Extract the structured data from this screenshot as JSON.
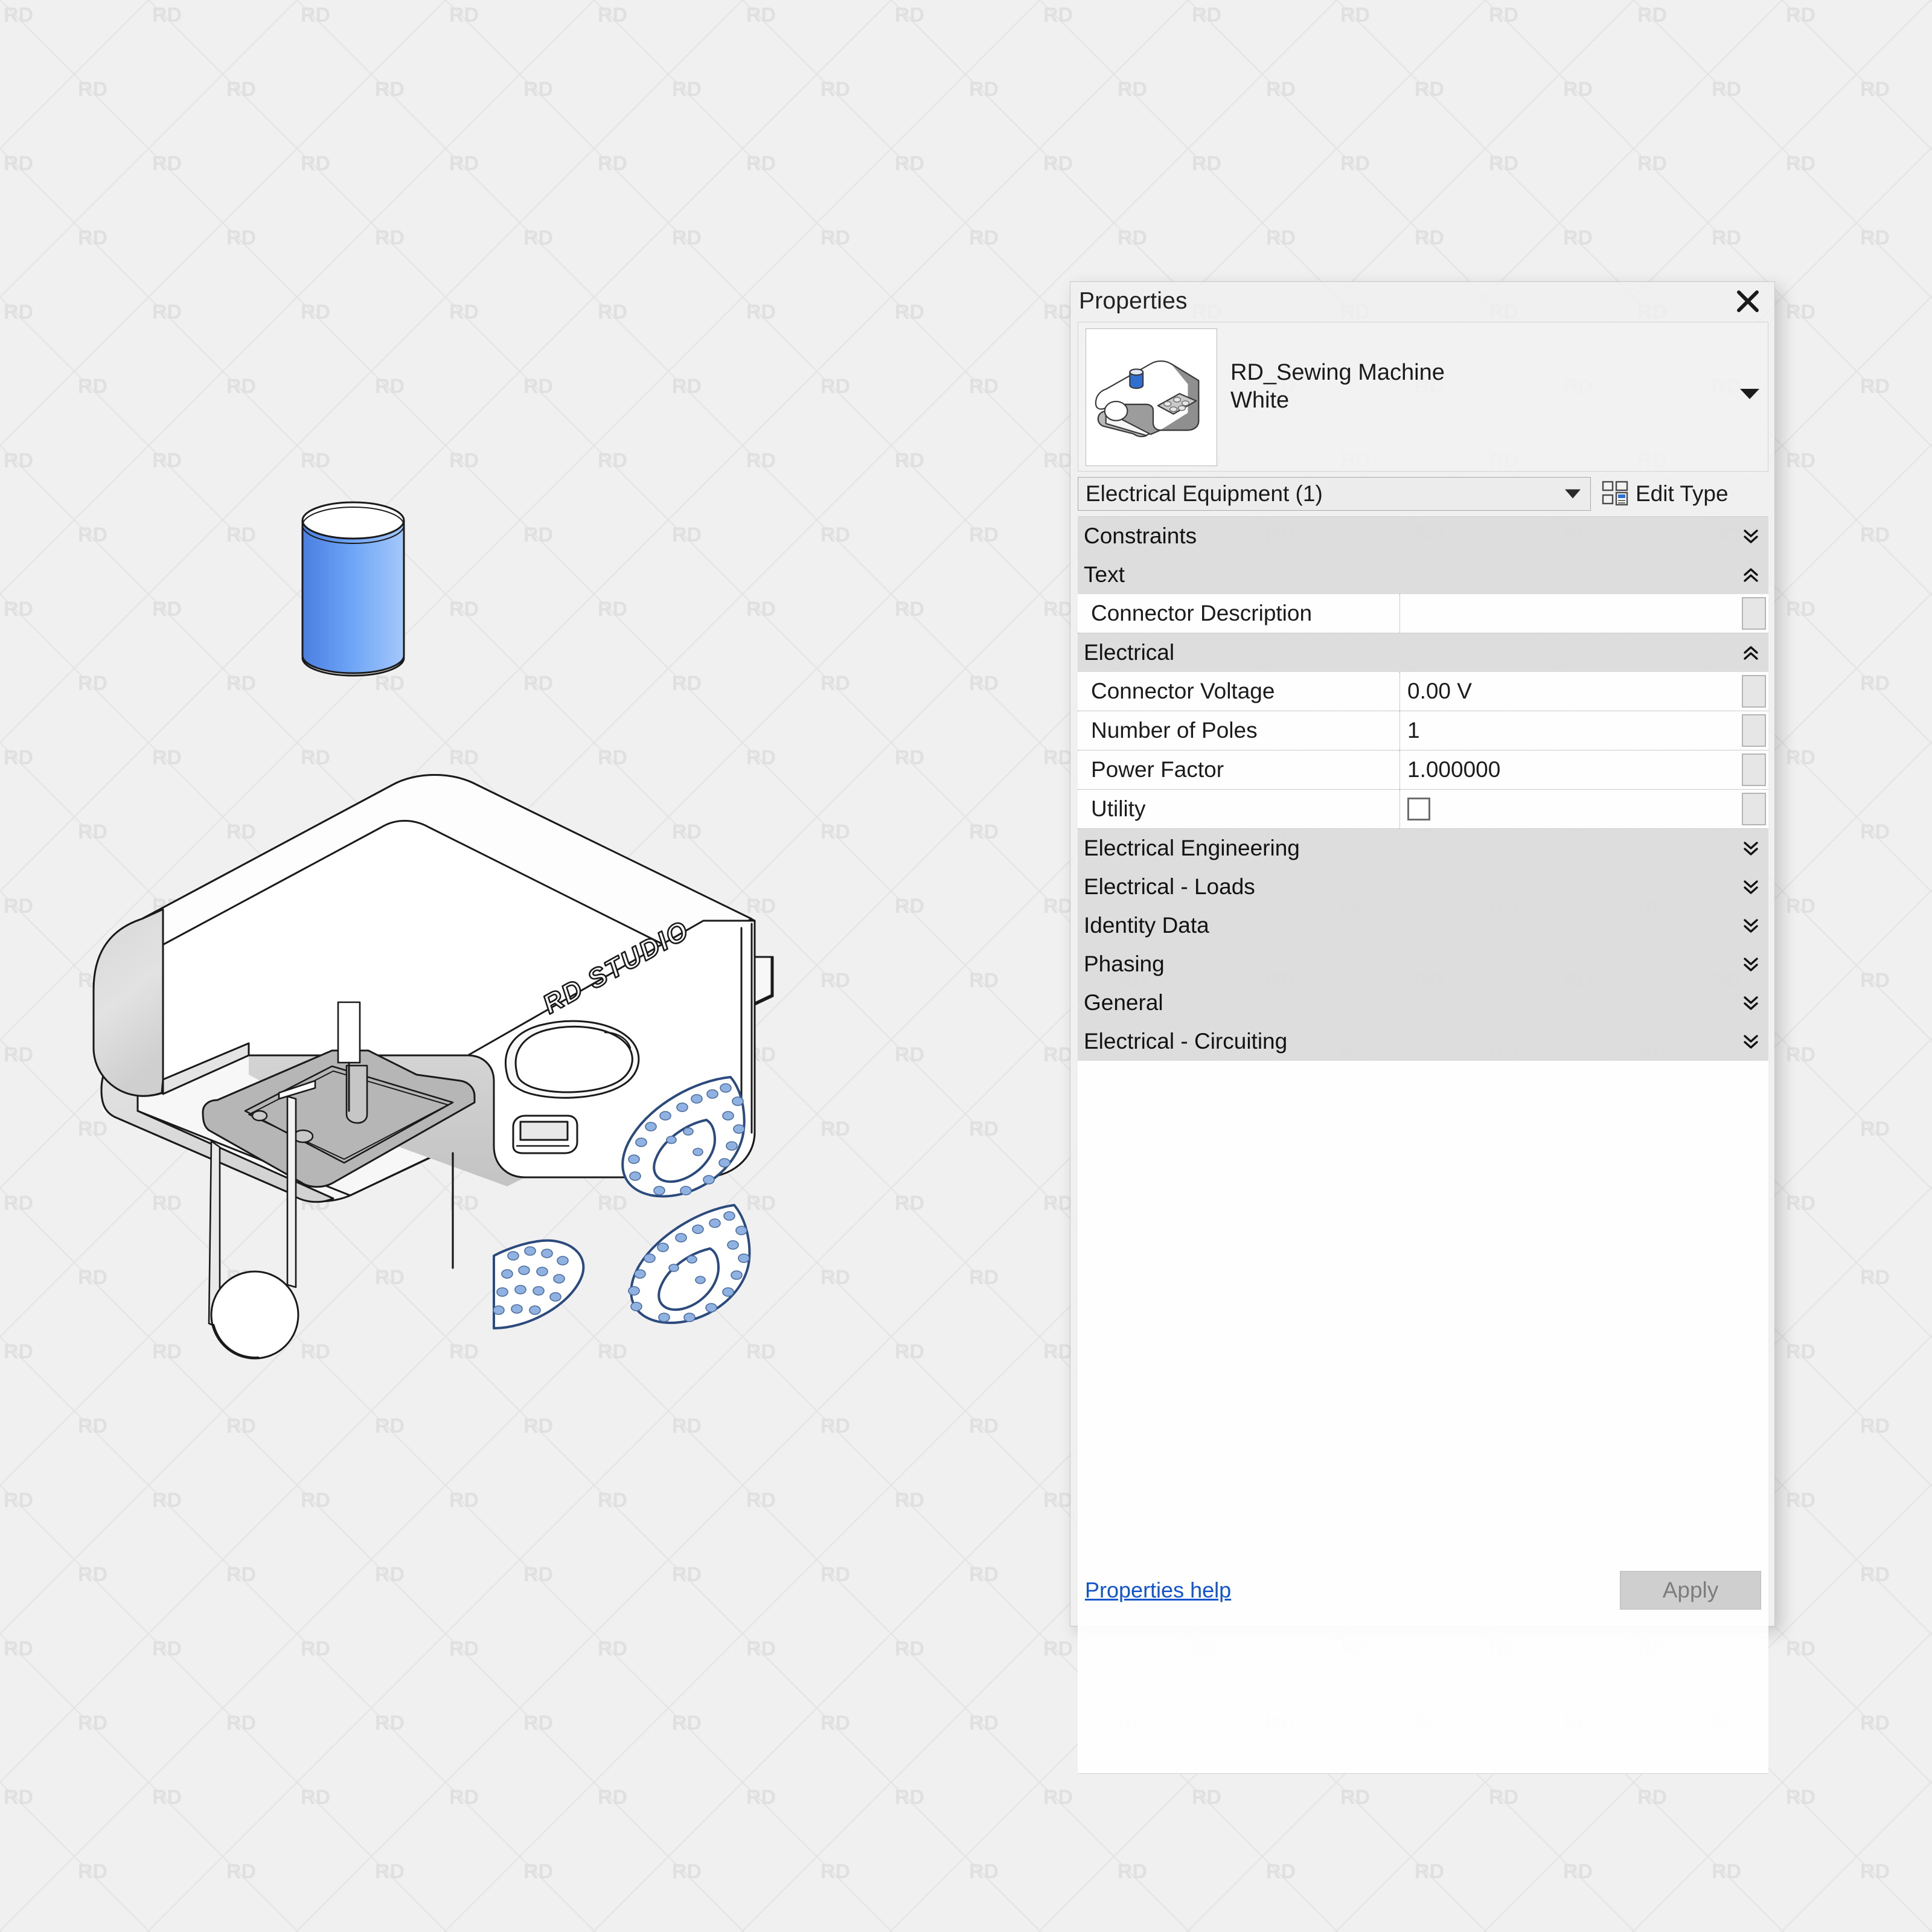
{
  "background": {
    "watermark_text": "RD",
    "bg_color": "#f0f0f0",
    "watermark_color": "#e2e2e2"
  },
  "panel": {
    "title": "Properties",
    "close_icon": "close-icon",
    "type_name_line1": "RD_Sewing Machine",
    "type_name_line2": "White",
    "type_dropdown_icon": "chevron-down-icon",
    "category": "Electrical Equipment (1)",
    "category_caret_icon": "chevron-down-icon",
    "edit_type_label": "Edit Type",
    "edit_type_icon": "edit-type-icon",
    "preview_icon": "sewing-machine-preview",
    "help_link": "Properties help",
    "apply_label": "Apply"
  },
  "prop_grid": {
    "rows": [
      {
        "kind": "group",
        "label": "Constraints",
        "state": "collapsed",
        "chev": "chevron-double-down-icon"
      },
      {
        "kind": "group",
        "label": "Text",
        "state": "expanded",
        "chev": "chevron-double-up-icon"
      },
      {
        "kind": "prop",
        "label": "Connector Description",
        "value": "",
        "value_type": "text"
      },
      {
        "kind": "group",
        "label": "Electrical",
        "state": "expanded",
        "chev": "chevron-double-up-icon"
      },
      {
        "kind": "prop",
        "label": "Connector Voltage",
        "value": "0.00 V",
        "value_type": "text"
      },
      {
        "kind": "prop",
        "label": "Number of Poles",
        "value": "1",
        "value_type": "text"
      },
      {
        "kind": "prop",
        "label": "Power Factor",
        "value": "1.000000",
        "value_type": "text"
      },
      {
        "kind": "prop",
        "label": "Utility",
        "value": "",
        "value_type": "checkbox",
        "checked": false
      },
      {
        "kind": "group",
        "label": "Electrical Engineering",
        "state": "collapsed",
        "chev": "chevron-double-down-icon"
      },
      {
        "kind": "group",
        "label": "Electrical - Loads",
        "state": "collapsed",
        "chev": "chevron-double-down-icon"
      },
      {
        "kind": "group",
        "label": "Identity Data",
        "state": "collapsed",
        "chev": "chevron-double-down-icon"
      },
      {
        "kind": "group",
        "label": "Phasing",
        "state": "collapsed",
        "chev": "chevron-double-down-icon"
      },
      {
        "kind": "group",
        "label": "General",
        "state": "collapsed",
        "chev": "chevron-double-down-icon"
      },
      {
        "kind": "group",
        "label": "Electrical - Circuiting",
        "state": "collapsed",
        "chev": "chevron-double-down-icon"
      }
    ]
  },
  "illustration": {
    "name": "sewing-machine-isometric-drawing",
    "brand_text": "RD STUDIO",
    "spool_color": "#4d8ef0",
    "outline_color": "#1a1a1a",
    "pattern_color": "#2b4a7d",
    "pattern_dot_color": "#89aee0"
  }
}
